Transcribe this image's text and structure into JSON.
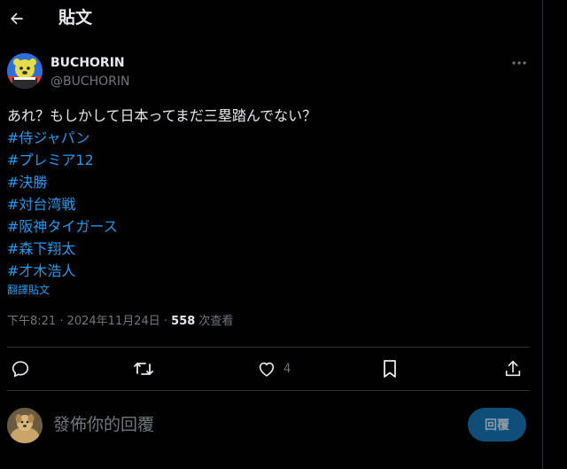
{
  "header": {
    "title": "貼文"
  },
  "post": {
    "author_name": "BUCHORIN",
    "author_handle": "@BUCHORIN",
    "text": "あれ？もしかして日本ってまだ三塁踏んでない？",
    "hashtags": [
      "#侍ジャパン",
      "#プレミア12",
      "#決勝",
      "#対台湾戦",
      "#阪神タイガース",
      "#森下翔太",
      "#才木浩人"
    ],
    "translate_label": "翻譯貼文",
    "timestamp": "下午8:21 · 2024年11月24日 · ",
    "views_count": "558",
    "views_label": " 次查看"
  },
  "actions": {
    "like_count": "4"
  },
  "reply": {
    "placeholder": "發佈你的回覆",
    "button_label": "回覆"
  },
  "colors": {
    "accent": "#1d9bf0",
    "background": "#000000",
    "text": "#e7e9ea",
    "muted": "#71767b",
    "divider": "#2f3336"
  },
  "icons": [
    "back-arrow-icon",
    "more-icon",
    "reply-icon",
    "repost-icon",
    "like-icon",
    "bookmark-icon",
    "share-icon"
  ]
}
